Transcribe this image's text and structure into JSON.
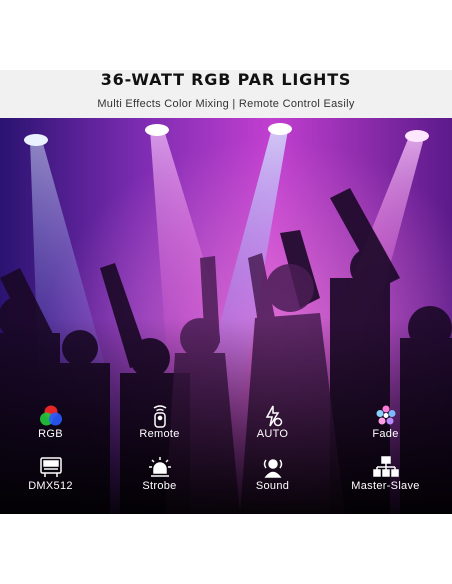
{
  "header": {
    "title": "36-WATT RGB PAR LIGHTS",
    "subtitle": "Multi Effects Color Mixing | Remote Control Easily"
  },
  "photo": {
    "description_icon": "concert-crowd-image",
    "colors": {
      "purple": "#8a2bd6",
      "magenta": "#e03cc8",
      "blue": "#3f6cf0",
      "dark": "#14061f"
    }
  },
  "features": [
    {
      "label": "RGB",
      "icon": "rgb-icon"
    },
    {
      "label": "Remote",
      "icon": "remote-icon"
    },
    {
      "label": "AUTO",
      "icon": "auto-icon"
    },
    {
      "label": "Fade",
      "icon": "fade-icon"
    },
    {
      "label": "DMX512",
      "icon": "dmx-icon"
    },
    {
      "label": "Strobe",
      "icon": "strobe-icon"
    },
    {
      "label": "Sound",
      "icon": "sound-icon"
    },
    {
      "label": "Master-Slave",
      "icon": "master-slave-icon"
    }
  ]
}
